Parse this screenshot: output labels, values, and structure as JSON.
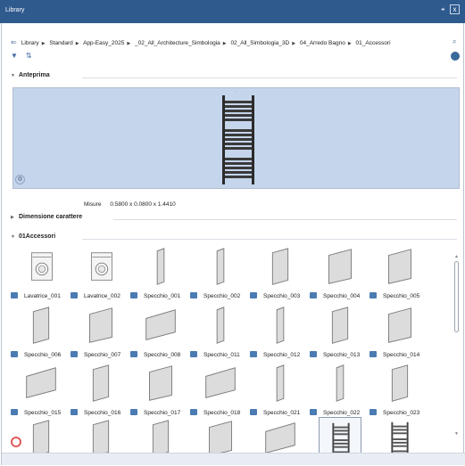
{
  "window": {
    "title": "Library",
    "pin": "⌖",
    "close": "x"
  },
  "breadcrumb": {
    "back_icon": "back-arrow-icon",
    "items": [
      "Library",
      "Standard",
      "App-Easy_2025",
      "_02_All_Architecture_Simbologia",
      "02_All_Simbologia_3D",
      "04_Arredo Bagno",
      "01_Accessori"
    ]
  },
  "toolbar": {
    "filter_icon": "filter-icon",
    "sort_icon": "sort-icon",
    "globe_icon": "globe-icon",
    "search_icon": "search-icon"
  },
  "sections": {
    "preview": "Anteprima",
    "font_size": "Dimensione carattere",
    "folder": "01Accessori"
  },
  "preview": {
    "dims_label": "Misure",
    "dims_value": "0.5800 x 0.0800 x 1.4410"
  },
  "items": [
    {
      "label": "Lavatrice_001",
      "kind": "washer"
    },
    {
      "label": "Lavatrice_002",
      "kind": "washer"
    },
    {
      "label": "Specchio_001",
      "kind": "panel-narrow"
    },
    {
      "label": "Specchio_002",
      "kind": "panel-narrow"
    },
    {
      "label": "Specchio_003",
      "kind": "panel"
    },
    {
      "label": "Specchio_004",
      "kind": "panel-wide"
    },
    {
      "label": "Specchio_005",
      "kind": "panel-wide"
    },
    {
      "label": "Specchio_006",
      "kind": "panel"
    },
    {
      "label": "Specchio_007",
      "kind": "panel-wide"
    },
    {
      "label": "Specchio_008",
      "kind": "panel-xwide"
    },
    {
      "label": "Specchio_011",
      "kind": "panel-narrow"
    },
    {
      "label": "Specchio_012",
      "kind": "panel-narrow"
    },
    {
      "label": "Specchio_013",
      "kind": "panel"
    },
    {
      "label": "Specchio_014",
      "kind": "panel-wide"
    },
    {
      "label": "Specchio_015",
      "kind": "panel-xwide"
    },
    {
      "label": "Specchio_016",
      "kind": "panel"
    },
    {
      "label": "Specchio_017",
      "kind": "panel-wide"
    },
    {
      "label": "Specchio_018",
      "kind": "panel-xwide"
    },
    {
      "label": "Specchio_021",
      "kind": "panel-narrow"
    },
    {
      "label": "Specchio_022",
      "kind": "panel-narrow"
    },
    {
      "label": "Specchio_023",
      "kind": "panel"
    },
    {
      "label": "",
      "kind": "panel"
    },
    {
      "label": "",
      "kind": "panel"
    },
    {
      "label": "",
      "kind": "panel"
    },
    {
      "label": "",
      "kind": "panel-wide"
    },
    {
      "label": "",
      "kind": "panel-xwide"
    },
    {
      "label": "",
      "kind": "radiator"
    },
    {
      "label": "",
      "kind": "radiator"
    }
  ],
  "selected_index": 26
}
